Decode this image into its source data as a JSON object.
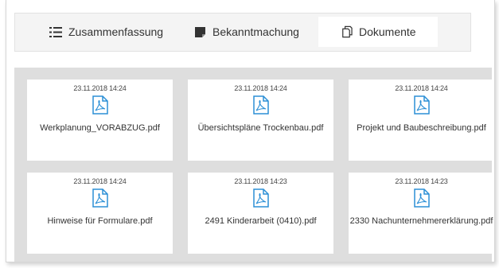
{
  "tabs": [
    {
      "label": "Zusammenfassung",
      "icon": "list-icon",
      "active": false
    },
    {
      "label": "Bekanntmachung",
      "icon": "note-icon",
      "active": false
    },
    {
      "label": "Dokumente",
      "icon": "documents-icon",
      "active": true
    }
  ],
  "documents": [
    {
      "date": "23.11.2018 14:24",
      "name": "Werkplanung_VORABZUG.pdf",
      "icon": "pdf-file-icon"
    },
    {
      "date": "23.11.2018 14:24",
      "name": "Übersichtspläne Trockenbau.pdf",
      "icon": "pdf-file-icon"
    },
    {
      "date": "23.11.2018 14:24",
      "name": "Projekt und Baubeschreibung.pdf",
      "icon": "pdf-file-icon"
    },
    {
      "date": "23.11.2018 14:24",
      "name": "Hinweise für Formulare.pdf",
      "icon": "pdf-file-icon"
    },
    {
      "date": "23.11.2018 14:23",
      "name": "2491 Kinderarbeit (0410).pdf",
      "icon": "pdf-file-icon"
    },
    {
      "date": "23.11.2018 14:23",
      "name": "2330 Nachunternehmererklärung.pdf",
      "icon": "pdf-file-icon"
    }
  ],
  "colors": {
    "accent": "#2b8fd6",
    "grid_background": "#dedede",
    "tabbar_background": "#f4f4f4"
  }
}
